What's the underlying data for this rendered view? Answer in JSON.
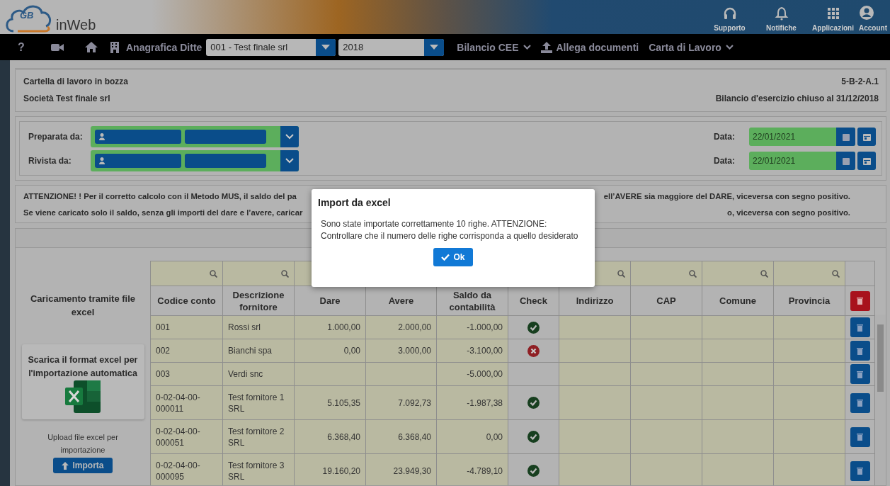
{
  "brand": {
    "logo_mark": "GB",
    "name": "inWeb"
  },
  "top_actions": [
    {
      "label": "Supporto"
    },
    {
      "label": "Notifiche"
    },
    {
      "label": "Applicazioni"
    },
    {
      "label": "Account"
    }
  ],
  "navbar": {
    "help": "?",
    "company_label": "Anagrafica Ditte",
    "company_select": "001 - Test finale srl",
    "year_select": "2018",
    "menus": [
      {
        "kind": "dropdown",
        "label": "Bilancio CEE"
      },
      {
        "kind": "upload",
        "label": "Allega documenti"
      },
      {
        "kind": "dropdown",
        "label": "Carta di Lavoro"
      }
    ]
  },
  "header": {
    "status": "Cartella di lavoro in bozza",
    "company": "Società Test finale srl",
    "code": "5-B-2-A.1",
    "period": "Bilancio d'esercizio chiuso al 31/12/2018"
  },
  "signoff": [
    {
      "label": "Preparata da:",
      "date_label": "Data:",
      "date": "22/01/2021"
    },
    {
      "label": "Rivista da:",
      "date_label": "Data:",
      "date": "22/01/2021"
    }
  ],
  "notice": [
    {
      "left": "ATTENZIONE! ! Per il corretto calcolo con il Metodo MUS, il saldo del pa",
      "right": "ell’AVERE sia maggiore del DARE, viceversa con segno positivo."
    },
    {
      "left": "Se viene caricato solo il saldo, senza gli importi del dare e l’avere, caricar",
      "right": "o, viceversa con segno positivo."
    }
  ],
  "upload_panel": {
    "title": "Caricamento tramite file excel",
    "template_card": "Scarica il format excel per l'importazione automatica",
    "upload_hint": "Upload file excel per importazione",
    "import_button": "Importa"
  },
  "table": {
    "columns": [
      {
        "label": "Codice conto",
        "filter": true
      },
      {
        "label": "Descrizione fornitore",
        "filter": true
      },
      {
        "label": "Dare"
      },
      {
        "label": "Avere"
      },
      {
        "label": "Saldo da contabilità"
      },
      {
        "label": "Check"
      },
      {
        "label": "Indirizzo",
        "filter": true
      },
      {
        "label": "CAP",
        "filter": true
      },
      {
        "label": "Comune",
        "filter": true
      },
      {
        "label": "Provincia",
        "filter": true
      }
    ],
    "rows": [
      {
        "cells": [
          "001",
          "Rossi srl",
          "1.000,00",
          "2.000,00",
          "-1.000,00"
        ],
        "kind": "ok"
      },
      {
        "cells": [
          "002",
          "Bianchi spa",
          "0,00",
          "3.000,00",
          "-3.100,00"
        ],
        "kind": "error"
      },
      {
        "cells": [
          "003",
          "Verdi snc",
          "",
          "",
          "-5.000,00"
        ],
        "kind": "empty"
      },
      {
        "cells": [
          "0-02-04-00-000011",
          "Test fornitore 1 SRL",
          "5.105,35",
          "7.092,73",
          "-1.987,38"
        ],
        "kind": "ok"
      },
      {
        "cells": [
          "0-02-04-00-000051",
          "Test fornitore 2 SRL",
          "6.368,40",
          "6.368,40",
          "0,00"
        ],
        "kind": "ok"
      },
      {
        "cells": [
          "0-02-04-00-000095",
          "Test fornitore 3 SRL",
          "19.160,20",
          "23.949,30",
          "-4.789,10"
        ],
        "kind": "ok"
      }
    ]
  },
  "dialog": {
    "title": "Import da excel",
    "message": "Sono state importate correttamente 10 righe. ATTENZIONE: Controllare che il numero delle righe corrisponda a quello desiderato",
    "button": "Ok"
  }
}
